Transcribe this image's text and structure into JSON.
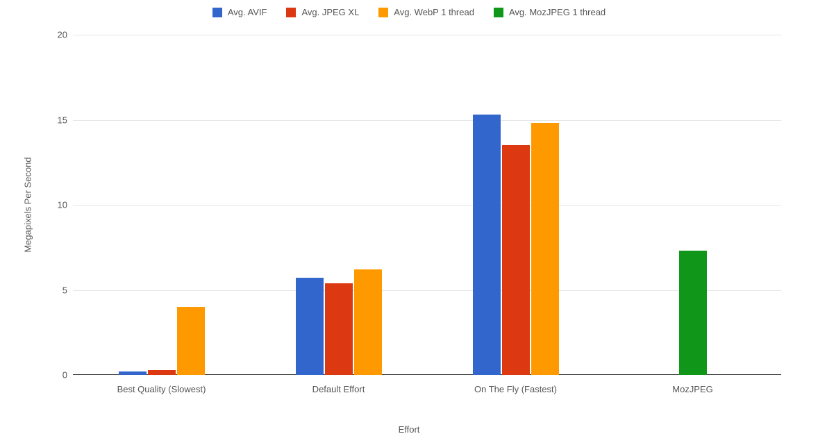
{
  "chart_data": {
    "type": "bar",
    "title": "",
    "xlabel": "Effort",
    "ylabel": "Megapixels Per Second",
    "ylim": [
      0,
      20
    ],
    "yticks": [
      0,
      5,
      10,
      15,
      20
    ],
    "categories": [
      "Best Quality (Slowest)",
      "Default Effort",
      "On The Fly (Fastest)",
      "MozJPEG"
    ],
    "series": [
      {
        "name": "Avg. AVIF",
        "color": "#3366cc",
        "values": [
          0.2,
          5.7,
          15.3,
          null
        ]
      },
      {
        "name": "Avg. JPEG XL",
        "color": "#dc3912",
        "values": [
          0.3,
          5.4,
          13.5,
          null
        ]
      },
      {
        "name": "Avg. WebP 1 thread",
        "color": "#ff9900",
        "values": [
          4.0,
          6.2,
          14.8,
          null
        ]
      },
      {
        "name": "Avg. MozJPEG 1 thread",
        "color": "#109618",
        "values": [
          null,
          null,
          null,
          7.3
        ]
      }
    ]
  }
}
